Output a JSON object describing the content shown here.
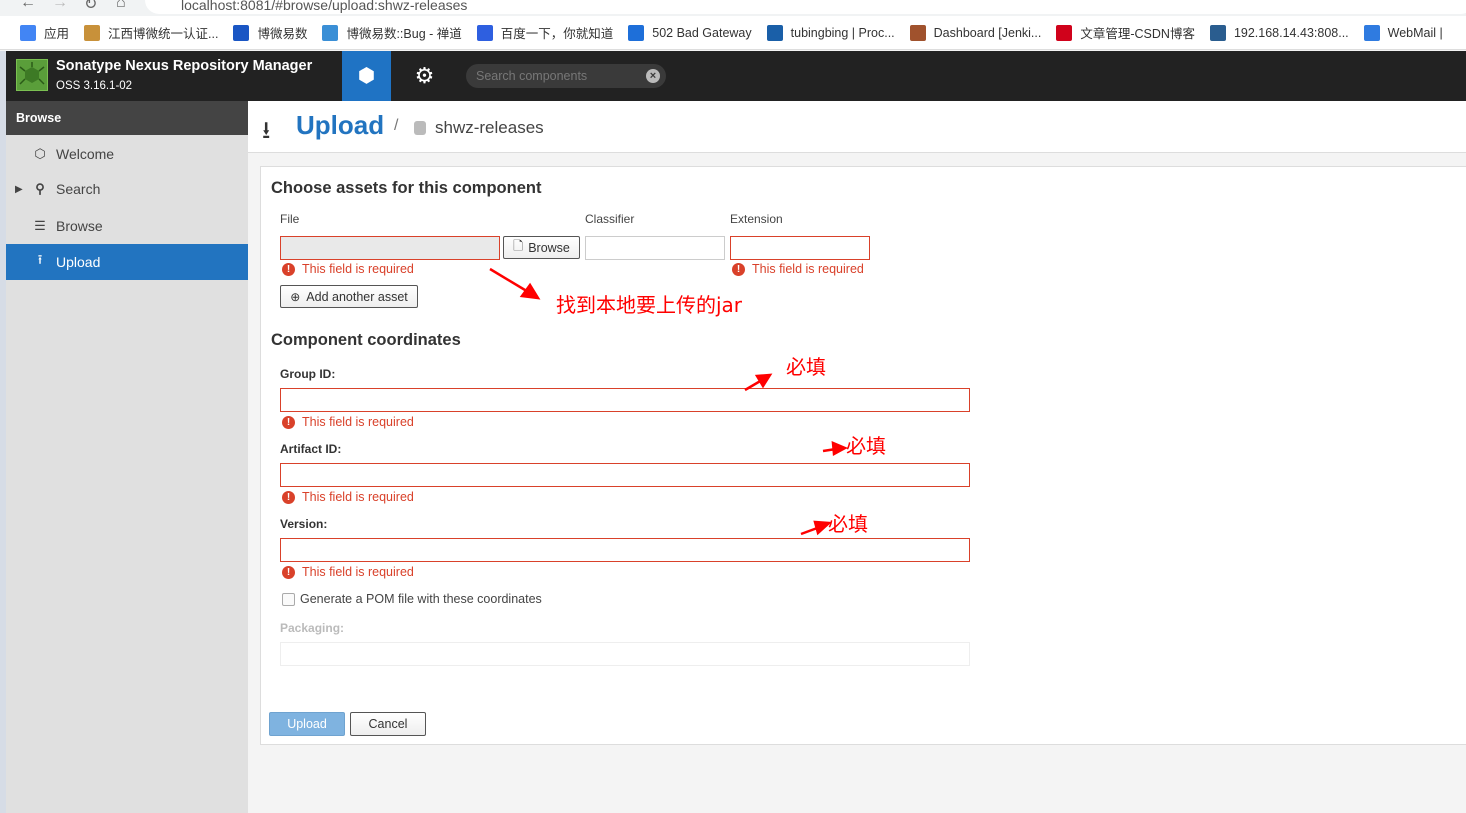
{
  "browser": {
    "url": "localhost:8081/#browse/upload:shwz-releases",
    "bookmarks": [
      {
        "label": "应用",
        "icon": "apps-grid-icon",
        "color": "#4285f4"
      },
      {
        "label": "江西博微统一认证...",
        "icon": "site-icon",
        "color": "#c8913a"
      },
      {
        "label": "博微易数",
        "icon": "chart-icon",
        "color": "#1a56c4"
      },
      {
        "label": "博微易数::Bug - 禅道",
        "icon": "globe-icon",
        "color": "#3a8fd6"
      },
      {
        "label": "百度一下，你就知道",
        "icon": "baidu-paw-icon",
        "color": "#2e5fe0"
      },
      {
        "label": "502 Bad Gateway",
        "icon": "c-icon",
        "color": "#1e6fd9"
      },
      {
        "label": "tubingbing | Proc...",
        "icon": "on-icon",
        "color": "#1a5fa8"
      },
      {
        "label": "Dashboard [Jenki...",
        "icon": "jenkins-icon",
        "color": "#a0522d"
      },
      {
        "label": "文章管理-CSDN博客",
        "icon": "csdn-icon",
        "color": "#d0021b"
      },
      {
        "label": "192.168.14.43:808...",
        "icon": "h2-icon",
        "color": "#2a5d8f"
      },
      {
        "label": "WebMail |",
        "icon": "mail-icon",
        "color": "#2f7be0"
      }
    ]
  },
  "header": {
    "app_name": "Sonatype Nexus Repository Manager",
    "version": "OSS 3.16.1-02",
    "search_placeholder": "Search components",
    "accent": "#1f73c4"
  },
  "sidebar": {
    "title": "Browse",
    "items": [
      {
        "label": "Welcome",
        "icon": "hexagon-icon"
      },
      {
        "label": "Search",
        "icon": "search-icon"
      },
      {
        "label": "Browse",
        "icon": "database-icon"
      },
      {
        "label": "Upload",
        "icon": "upload-icon",
        "active": true
      }
    ]
  },
  "page": {
    "title": "Upload",
    "separator": "/",
    "repository": "shwz-releases"
  },
  "assets": {
    "heading": "Choose assets for this component",
    "file_label": "File",
    "classifier_label": "Classifier",
    "extension_label": "Extension",
    "browse_label": "Browse",
    "required_msg": "This field is required",
    "add_asset_label": "Add another asset"
  },
  "coordinates": {
    "heading": "Component coordinates",
    "group_label": "Group ID:",
    "artifact_label": "Artifact ID:",
    "version_label": "Version:",
    "required_msg": "This field is required",
    "pom_label": "Generate a POM file with these coordinates",
    "pom_checked": false,
    "packaging_label": "Packaging:"
  },
  "actions": {
    "upload_label": "Upload",
    "cancel_label": "Cancel"
  },
  "annotations": {
    "file_note": "找到本地要上传的jar",
    "required_1": "必填",
    "required_2": "必填",
    "required_3": "必填",
    "color": "#ff0000"
  }
}
